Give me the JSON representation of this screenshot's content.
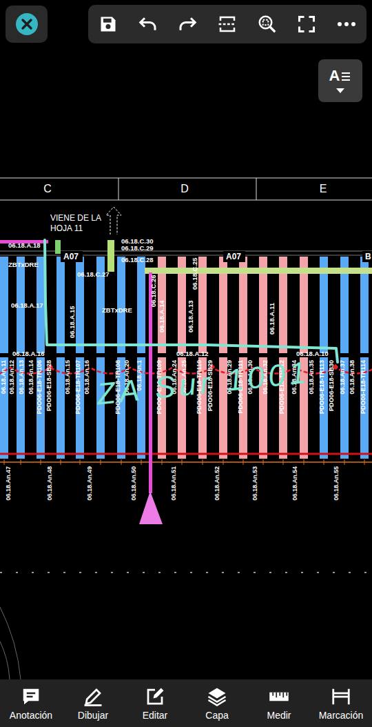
{
  "drawing": {
    "grid_columns": [
      "C",
      "D",
      "E"
    ],
    "note": [
      "VIENE DE LA",
      "HOJA 11"
    ],
    "upper_labels": [
      {
        "text": "06.18.A.18",
        "kind": "plain"
      },
      {
        "text": "06.18.C.30",
        "kind": "plain"
      },
      {
        "text": "06.18.C.29",
        "kind": "plain"
      },
      {
        "text": "06.18.C.28",
        "kind": "plain"
      },
      {
        "text": "A07",
        "kind": "tag"
      },
      {
        "text": "A07",
        "kind": "tag"
      },
      {
        "text": "B",
        "kind": "tag"
      },
      {
        "text": "ZBTxDRE",
        "kind": "plain"
      },
      {
        "text": "06.18.C.27",
        "kind": "plain"
      },
      {
        "text": "06.18.A.17",
        "kind": "plain"
      },
      {
        "text": "ZBTxDRE",
        "kind": "plain"
      },
      {
        "text": "06.18.A.16",
        "kind": "plain"
      },
      {
        "text": "06.18.A.12",
        "kind": "plain"
      },
      {
        "text": "06.18.A.10",
        "kind": "plain"
      },
      {
        "text": "06.18.A.15",
        "kind": "vertical"
      },
      {
        "text": "06.18.C.26",
        "kind": "vertical"
      },
      {
        "text": "06.18.A.14",
        "kind": "vertical"
      },
      {
        "text": "06.18.C.25",
        "kind": "vertical"
      },
      {
        "text": "06.18.A.13",
        "kind": "vertical"
      },
      {
        "text": "06.18.A.11",
        "kind": "vertical"
      }
    ],
    "upper_bars": [
      {
        "color": "#5aa9f5"
      },
      {
        "color": "#5aa9f5"
      },
      {
        "color": "#5aa9f5"
      },
      {
        "color": "#5aa9f5"
      },
      {
        "color": "#5aa9f5"
      },
      {
        "color": "#5aa9f5"
      },
      {
        "color": "#5aa9f5"
      },
      {
        "color": "#5aa9f5"
      },
      {
        "color": "#f4a3a8"
      },
      {
        "color": "#f4a3a8"
      },
      {
        "color": "#f4a3a8"
      },
      {
        "color": "#f4a3a8"
      },
      {
        "color": "#f4a3a8"
      },
      {
        "color": "#f4a3a8"
      },
      {
        "color": "#f4a3a8"
      },
      {
        "color": "#f4a3a8"
      },
      {
        "color": "#5aa9f5"
      },
      {
        "color": "#5aa9f5"
      },
      {
        "color": "#5aa9f5"
      }
    ],
    "lower_bars": [
      {
        "color": "#5aa9f5"
      },
      {
        "color": "#5aa9f5"
      },
      {
        "color": "#5aa9f5"
      },
      {
        "color": "#5aa9f5"
      },
      {
        "color": "#5aa9f5"
      },
      {
        "color": "#5aa9f5"
      },
      {
        "color": "#5aa9f5"
      },
      {
        "color": "#5aa9f5"
      },
      {
        "color": "#f4a3a8"
      },
      {
        "color": "#f4a3a8"
      },
      {
        "color": "#f4a3a8"
      },
      {
        "color": "#f4a3a8"
      },
      {
        "color": "#f4a3a8"
      },
      {
        "color": "#f4a3a8"
      },
      {
        "color": "#f4a3a8"
      },
      {
        "color": "#f4a3a8"
      },
      {
        "color": "#5aa9f5"
      },
      {
        "color": "#5aa9f5"
      },
      {
        "color": "#5aa9f5"
      }
    ],
    "lower_labels": [
      "06.18.An.11",
      "06.18.An.12",
      "06.18.An.13",
      "06.18.An.14",
      "PDO06-E18-TR106",
      "PDO06-E18-SB28",
      "06.18.An.15",
      "PDO06-E18-TR107",
      "06.18.An.16",
      "PDO06-E18-TR108",
      "06.18.An.20",
      "06.18.An.1",
      "PDO06-E18-TR109",
      "06.18.An.24",
      "06.18.An.25",
      "PDO06-E18-TR110",
      "PDO06-E18-SB29",
      "06.18.An.29",
      "PDO06-E18-TR111",
      "06.18.An.30",
      "06.18.An.32",
      "PDO06-E18-TR112",
      "06.18.An.34",
      "06.18.An.35",
      "PDO06-E18-TR113",
      "PDO06-E18-SB30",
      "06.18.An.37",
      "06.18.An.38",
      "PDO06-E18-TR114"
    ],
    "station_labels": [
      "06.18.An.47",
      "06.18.An.48",
      "06.18.An.49",
      "06.18.An.50",
      "06.18.An.51",
      "06.18.An.52",
      "06.18.An.53",
      "06.18.An.54",
      "06.18.An.55"
    ],
    "annotation": "ZA Sur 1001"
  },
  "text_style_button": {
    "label": "A"
  },
  "bottom_nav": [
    {
      "label": "Anotación"
    },
    {
      "label": "Dibujar"
    },
    {
      "label": "Editar"
    },
    {
      "label": "Capa"
    },
    {
      "label": "Medir"
    },
    {
      "label": "Marcación"
    }
  ]
}
